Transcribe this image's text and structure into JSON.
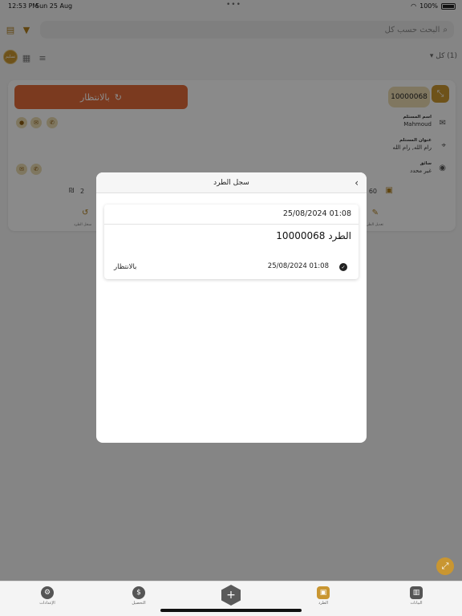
{
  "status_bar": {
    "time": "12:53 PM",
    "date": "Sun 25 Aug",
    "battery": "100%"
  },
  "search": {
    "placeholder": "البحث حسب كل"
  },
  "filter": {
    "count_label": "(1) كل"
  },
  "avatar": {
    "label": "تسليم"
  },
  "card": {
    "status_label": "بالانتظار",
    "package_id": "10000068",
    "customer_name_label": "اسم المستلم",
    "customer_name": "Mahmoud",
    "address_label": "عنوان المستلم",
    "address": "رام الله, رام الله",
    "driver_label": "سائق",
    "driver": "غير محدد",
    "price": "60",
    "count": "2",
    "action_left_label": "سجل الطرد",
    "action_right_label": "تعديل الطرد"
  },
  "modal": {
    "title": "سجل الطرد",
    "header_date": "25/08/2024 01:08",
    "package_title": "الطرد 10000068",
    "entry": {
      "date": "25/08/2024 01:08",
      "status": "بالانتظار"
    }
  },
  "tabs": [
    {
      "label": "الإعدادات",
      "icon": "gear-icon"
    },
    {
      "label": "التحصيل",
      "icon": "dollar-icon"
    },
    {
      "label": "الطرد",
      "icon": "box-icon"
    },
    {
      "label": "البيانات",
      "icon": "chart-icon"
    }
  ],
  "colors": {
    "accent": "#c99631",
    "status_button": "#e06a3a"
  }
}
